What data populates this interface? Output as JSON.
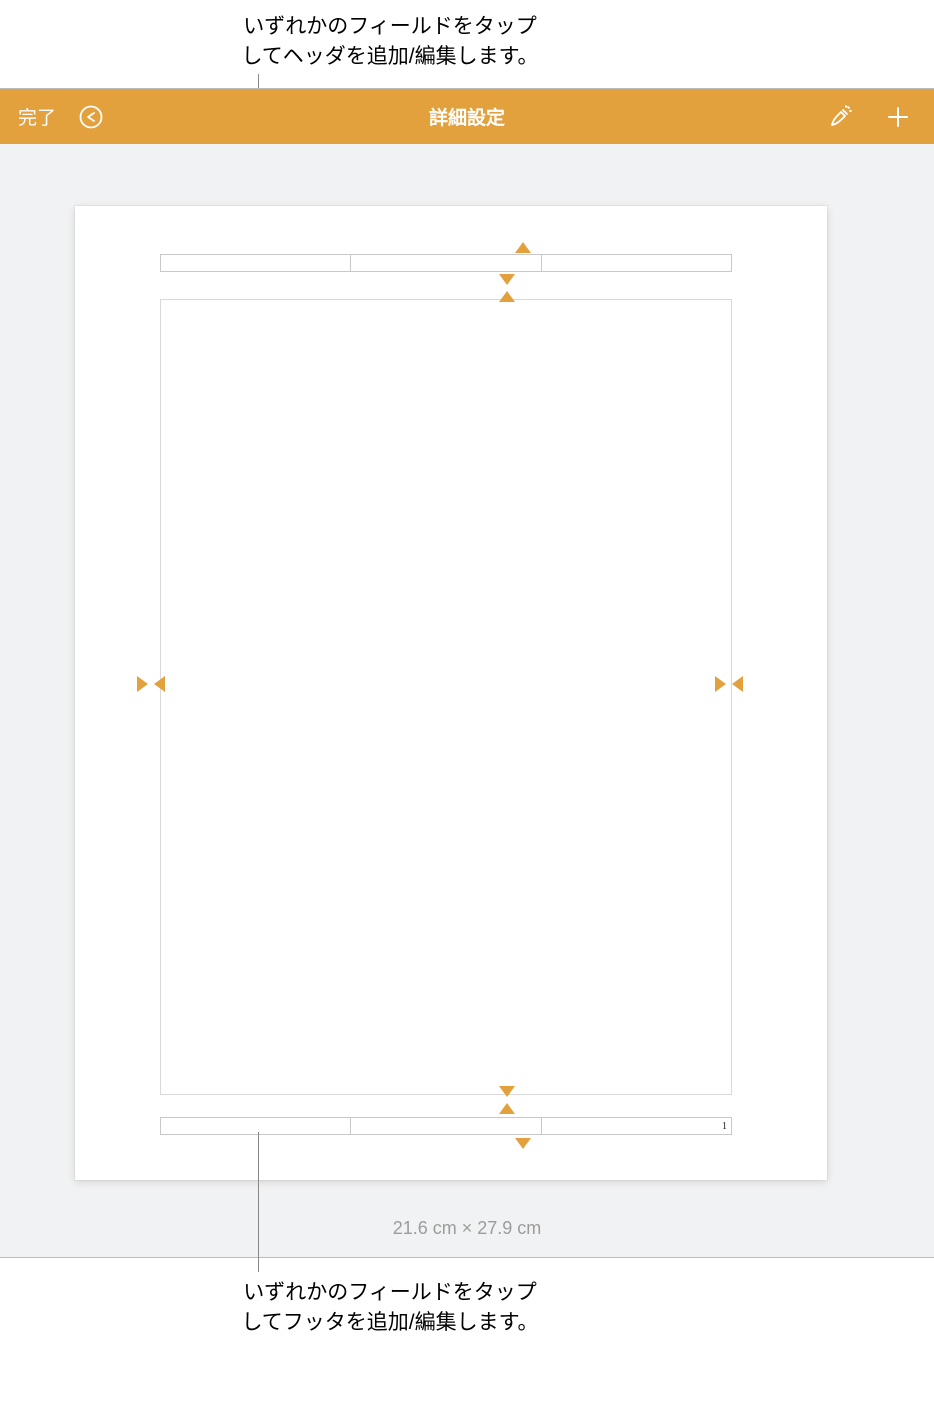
{
  "annotations": {
    "top_l1": "いずれかのフィールドをタップ",
    "top_l2": "してヘッダを追加/編集します。",
    "bottom_l1": "いずれかのフィールドをタップ",
    "bottom_l2": "してフッタを追加/編集します。"
  },
  "toolbar": {
    "done": "完了",
    "title": "詳細設定"
  },
  "page": {
    "header": {
      "left": "",
      "center": "",
      "right": ""
    },
    "footer": {
      "left": "",
      "center": "",
      "right": "1"
    },
    "dimensions": "21.6 cm × 27.9 cm"
  }
}
